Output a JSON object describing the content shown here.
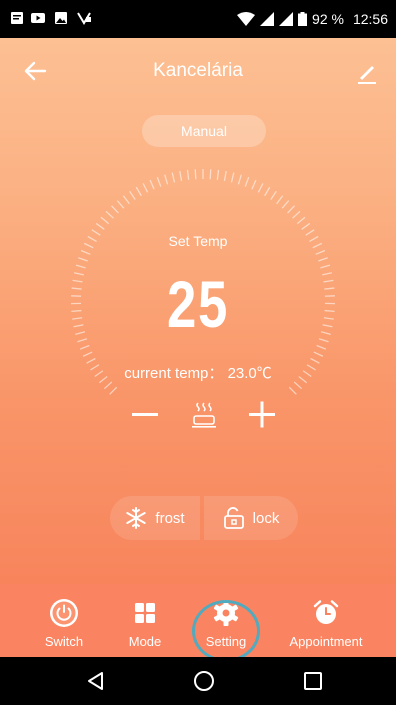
{
  "status_bar": {
    "battery": "92 %",
    "time": "12:56",
    "icons": [
      "message-icon",
      "youtube-icon",
      "gallery-icon",
      "app-notification-icon",
      "wifi-icon",
      "signal-icon",
      "signal-icon",
      "battery-icon"
    ]
  },
  "header": {
    "title": "Kancelária",
    "back_icon": "arrow-left-icon",
    "edit_icon": "pencil-icon"
  },
  "mode": {
    "label": "Manual"
  },
  "thermostat": {
    "set_label": "Set Temp",
    "set_value": "25",
    "current_label": "current temp：",
    "current_value": "23.0℃",
    "decrease_icon": "minus-icon",
    "heating_icon": "heating-icon",
    "increase_icon": "plus-icon"
  },
  "quick_actions": {
    "frost_label": "frost",
    "lock_label": "lock"
  },
  "bottom_nav": {
    "items": [
      {
        "label": "Switch",
        "icon": "power-icon"
      },
      {
        "label": "Mode",
        "icon": "grid-icon"
      },
      {
        "label": "Setting",
        "icon": "gear-icon"
      },
      {
        "label": "Appointment",
        "icon": "alarm-clock-icon"
      }
    ]
  },
  "colors": {
    "gradient_top": "#fcc093",
    "gradient_bottom": "#f8845c",
    "nav_background": "#fa8461",
    "highlight_ring": "#51aabd"
  }
}
